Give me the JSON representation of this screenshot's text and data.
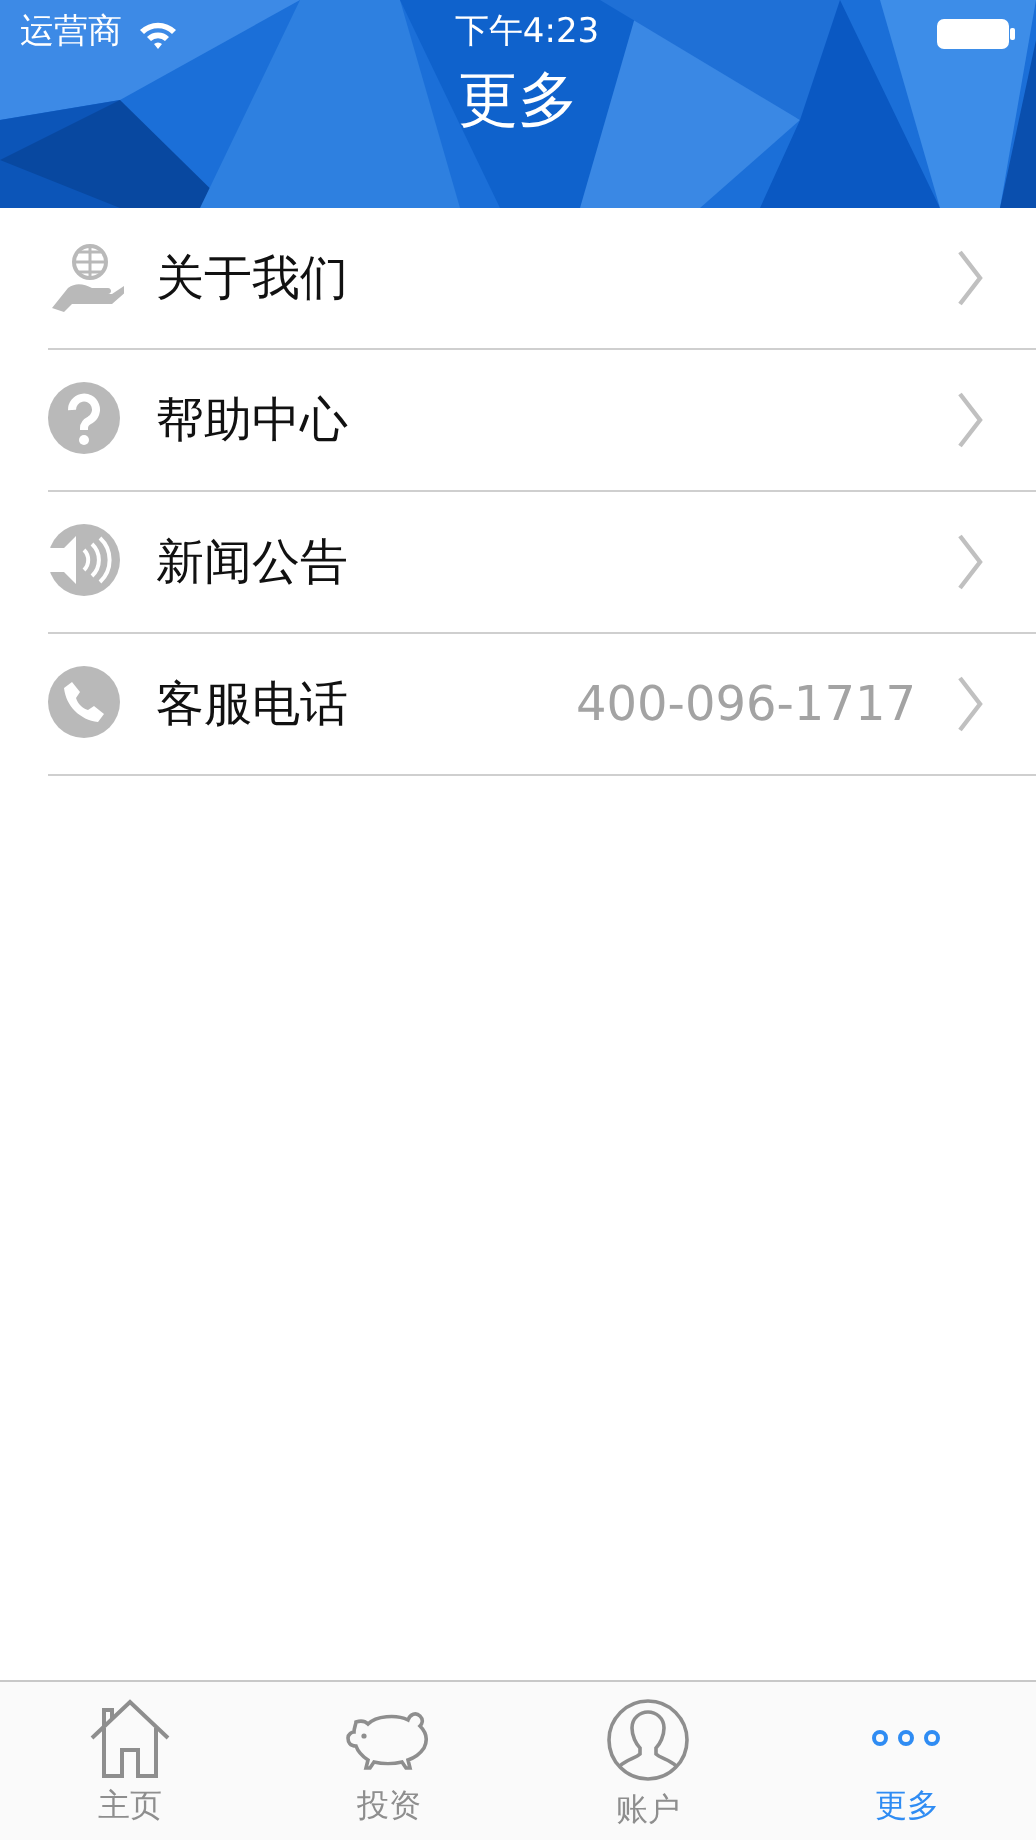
{
  "status_bar": {
    "carrier": "运营商",
    "time": "下午4:23"
  },
  "nav_bar": {
    "title": "更多"
  },
  "menu": [
    {
      "kind": "globe-hand",
      "label": "关于我们"
    },
    {
      "kind": "help",
      "label": "帮助中心"
    },
    {
      "kind": "speaker",
      "label": "新闻公告"
    },
    {
      "kind": "phone",
      "label": "客服电话",
      "value": "400-096-1717"
    }
  ],
  "tab_bar": [
    {
      "kind": "home",
      "label": "主页",
      "selected": false
    },
    {
      "kind": "piggy",
      "label": "投资",
      "selected": false
    },
    {
      "kind": "user",
      "label": "账户",
      "selected": false
    },
    {
      "kind": "more",
      "label": "更多",
      "selected": true
    }
  ]
}
